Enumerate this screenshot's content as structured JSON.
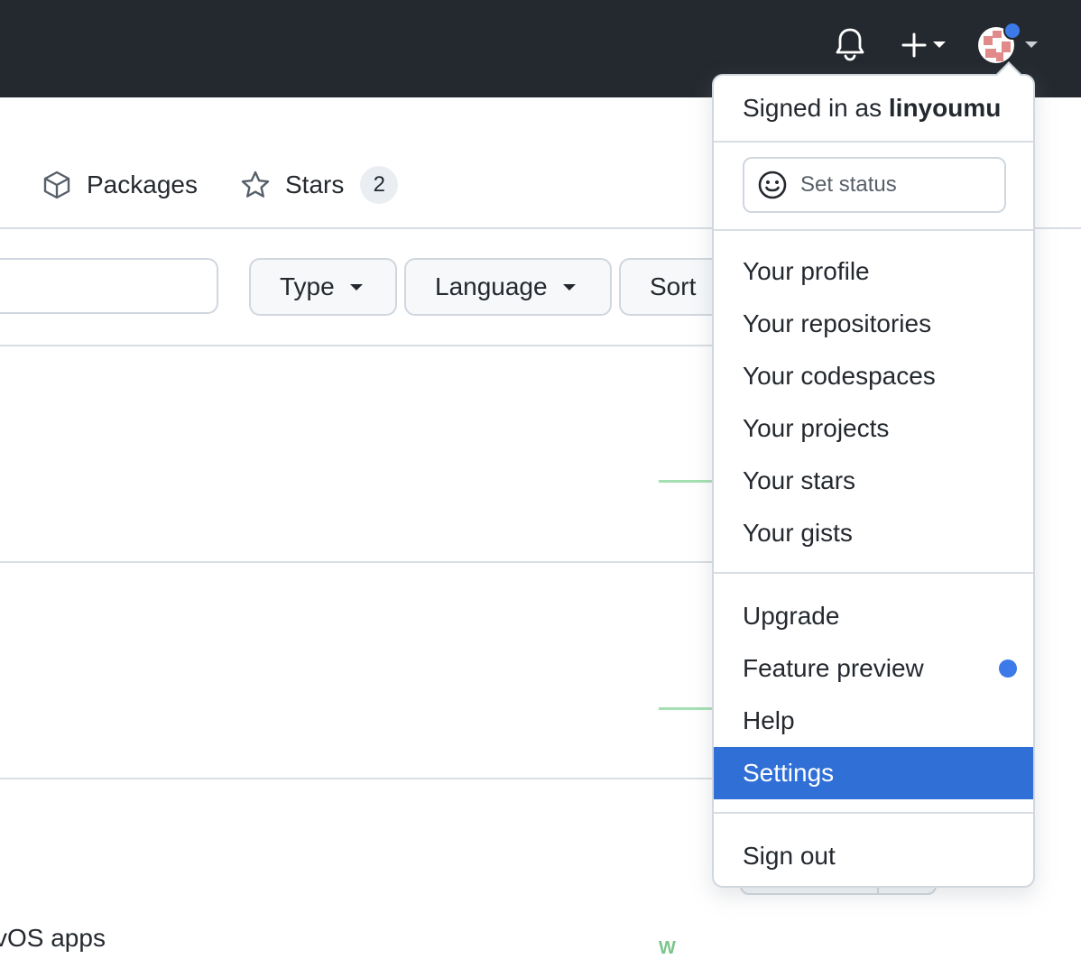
{
  "header": {
    "notifications_icon": "bell-icon",
    "create_icon": "plus-icon",
    "avatar_icon": "user-avatar"
  },
  "tabs": [
    {
      "label": "Packages",
      "icon": "package-icon"
    },
    {
      "label": "Stars",
      "icon": "star-icon",
      "count": "2"
    }
  ],
  "filters": {
    "type_label": "Type",
    "language_label": "Language",
    "sort_label": "Sort"
  },
  "partial_text": "vOS apps",
  "partial_badge": "W",
  "dropdown": {
    "signed_in_prefix": "Signed in as",
    "username": "linyoumu",
    "set_status": "Set status",
    "group1": [
      "Your profile",
      "Your repositories",
      "Your codespaces",
      "Your projects",
      "Your stars",
      "Your gists"
    ],
    "group2": [
      "Upgrade",
      "Feature preview",
      "Help",
      "Settings"
    ],
    "sign_out": "Sign out",
    "active_item": "Settings"
  },
  "colors": {
    "header_bg": "#24292f",
    "active_bg": "#2f6fd6",
    "dot_blue": "#3b7ae8"
  }
}
